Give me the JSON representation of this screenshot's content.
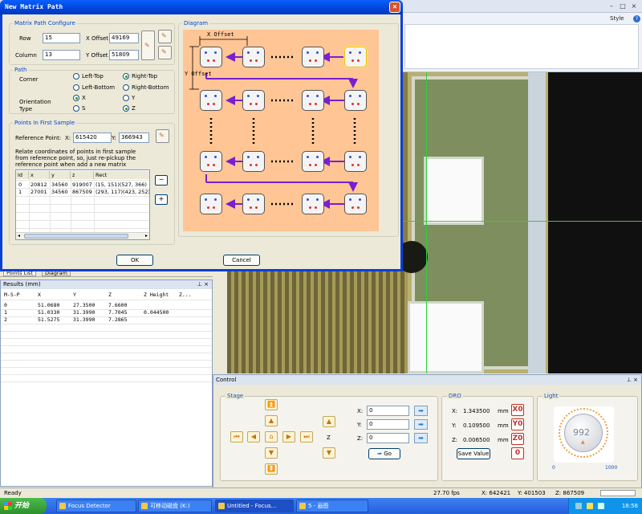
{
  "background_app": {
    "style_label": "Style",
    "help_label": "?"
  },
  "left_tabs": {
    "tab1": "Points List",
    "tab2": "Diagram"
  },
  "results": {
    "title": "Results (mm)",
    "pin": "⊥ ×",
    "headers": [
      "M-S-P",
      "X",
      "Y",
      "Z",
      "Z Height",
      "Z..."
    ],
    "rows": [
      [
        "0",
        "51.0680",
        "27.3500",
        "7.6600",
        ""
      ],
      [
        "1",
        "51.0330",
        "31.3990",
        "7.7045",
        "0.044500"
      ],
      [
        "2",
        "51.5275",
        "31.3990",
        "7.2865",
        ""
      ]
    ]
  },
  "control": {
    "title": "Control",
    "pin": "⊥ ×",
    "stage_label": "Stage",
    "dro_label": "DRO",
    "light_label": "Light",
    "z_label": "Z",
    "x_field_label": "X:",
    "y_field_label": "Y:",
    "z_field_label": "Z:",
    "x_value": "0",
    "y_value": "0",
    "z_value": "0",
    "go_label": "Go",
    "dro_x_label": "X:",
    "dro_y_label": "Y:",
    "dro_z_label": "Z:",
    "dro_x": "1.343500",
    "dro_y": "0.109500",
    "dro_z": "0.006500",
    "unit": "mm",
    "save_value_label": "Save Value",
    "x_zero": "X0",
    "y_zero": "Y0",
    "z_zero": "Z0",
    "zero_all": "0",
    "light_value": "992",
    "light_min": "0",
    "light_max": "1000"
  },
  "statusbar": {
    "ready": "Ready",
    "fps": "27.70 fps",
    "x": "X: 642421",
    "y": "Y: 401503",
    "z": "Z: 867509"
  },
  "taskbar": {
    "start": "开始",
    "tasks": [
      "Focus Detector",
      "可移动磁盘 (K:)",
      "Untitled - Focus...",
      "5 - 画图"
    ],
    "time": "18:58"
  },
  "dialog": {
    "title": "New Matrix Path",
    "close": "×",
    "matrix_group": "Matrix Path Configure",
    "row_label": "Row",
    "row_value": "15",
    "column_label": "Column",
    "column_value": "13",
    "x_offset_label": "X Offset",
    "x_offset_value": "49169",
    "y_offset_label": "Y Offset",
    "y_offset_value": "51809",
    "path_group": "Path",
    "corner_label": "Corner",
    "corner_options": [
      "Left-Top",
      "Right-Top",
      "Left-Bottom",
      "Right-Bottom"
    ],
    "corner_selected": "Right-Top",
    "orientation_label": "Orientation",
    "orientation_options": [
      "X",
      "Y"
    ],
    "orientation_selected": "X",
    "type_label": "Type",
    "type_options": [
      "S",
      "Z"
    ],
    "type_selected": "Z",
    "points_group": "Points In First Sample",
    "ref_label": "Reference Point:",
    "ref_x_label": "X:",
    "ref_x_value": "615420",
    "ref_y_label": "Y:",
    "ref_y_value": "366943",
    "relate_text": "Relate coordinates of points in first sample from reference point, so, just re-pickup the reference point when add a new matrix",
    "table_headers": [
      "Id",
      "x",
      "y",
      "z",
      "Rect"
    ],
    "table_rows": [
      [
        "0",
        "20812",
        "34560",
        "919007",
        "(15, 151)(527, 366)"
      ],
      [
        "1",
        "27001",
        "34560",
        "867509",
        "(293, 117)(423, 252)"
      ]
    ],
    "minus_label": "−",
    "plus_label": "+",
    "diagram_group": "Diagram",
    "diagram_x_offset": "X Offset",
    "diagram_y_offset": "Y Offset",
    "ok_label": "OK",
    "cancel_label": "Cancel"
  }
}
